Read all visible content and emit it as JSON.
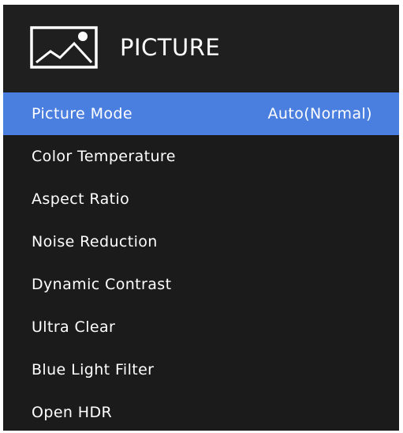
{
  "header": {
    "title": "PICTURE",
    "icon": "picture-icon"
  },
  "menu": {
    "selected_index": 0,
    "items": [
      {
        "label": "Picture Mode",
        "value": "Auto(Normal)"
      },
      {
        "label": "Color Temperature",
        "value": ""
      },
      {
        "label": "Aspect Ratio",
        "value": ""
      },
      {
        "label": "Noise Reduction",
        "value": ""
      },
      {
        "label": "Dynamic Contrast",
        "value": ""
      },
      {
        "label": "Ultra Clear",
        "value": ""
      },
      {
        "label": "Blue Light Filter",
        "value": ""
      },
      {
        "label": "Open HDR",
        "value": ""
      }
    ]
  },
  "colors": {
    "panel_background": "#1b1b1b",
    "selection_highlight": "#4a7fdf",
    "text": "#ffffff"
  }
}
